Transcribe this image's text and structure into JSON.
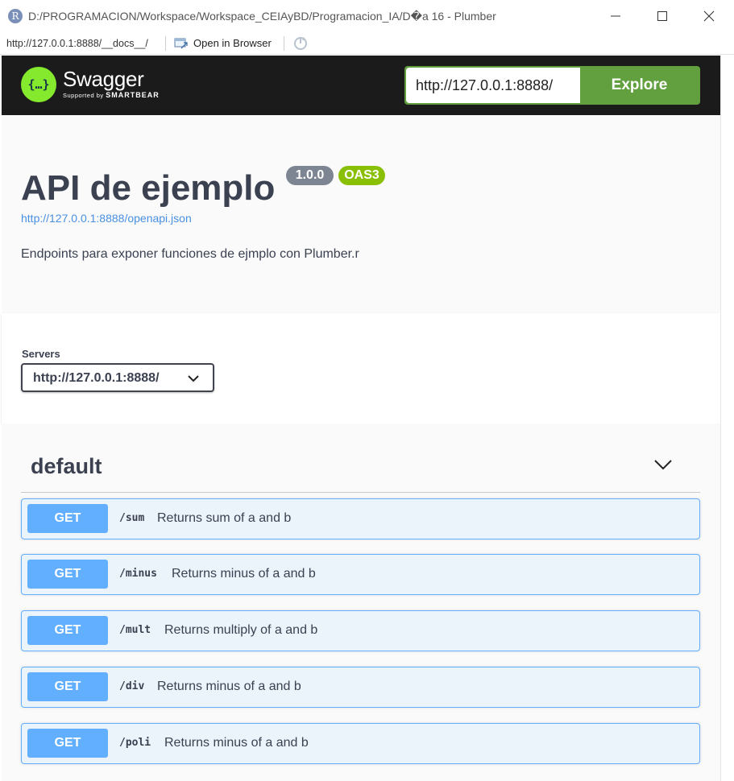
{
  "window": {
    "title": "D:/PROGRAMACION/Workspace/Workspace_CEIAyBD/Programacion_IA/D�a 16 - Plumber",
    "app_icon_letter": "R"
  },
  "toolbar": {
    "url": "http://127.0.0.1:8888/__docs__/",
    "open_in_browser": "Open in Browser"
  },
  "swagger": {
    "brand_name": "Swagger",
    "brand_sub_prefix": "Supported by",
    "brand_sub_company": "SMARTBEAR",
    "logo_glyph": "{…}",
    "explore_url": "http://127.0.0.1:8888/",
    "explore_label": "Explore",
    "accent_color": "#85ea2d",
    "explore_color": "#62a03f"
  },
  "info": {
    "title": "API de ejemplo",
    "version": "1.0.0",
    "oas": "OAS3",
    "spec_url": "http://127.0.0.1:8888/openapi.json",
    "description": "Endpoints para exponer funciones de ejmplo con Plumber.r"
  },
  "servers": {
    "label": "Servers",
    "selected": "http://127.0.0.1:8888/"
  },
  "tag": {
    "name": "default"
  },
  "operations": [
    {
      "method": "GET",
      "path": "/sum",
      "summary": "Returns sum of a and b"
    },
    {
      "method": "GET",
      "path": "/minus",
      "summary": "Returns minus of a and b"
    },
    {
      "method": "GET",
      "path": "/mult",
      "summary": "Returns multiply of a and b"
    },
    {
      "method": "GET",
      "path": "/div",
      "summary": "Returns minus of a and b"
    },
    {
      "method": "GET",
      "path": "/poli",
      "summary": "Returns minus of a and b"
    }
  ],
  "colors": {
    "get_method": "#61affe",
    "get_background": "#ebf3fb",
    "version_badge": "#7d8492",
    "oas_badge": "#89bf04"
  }
}
